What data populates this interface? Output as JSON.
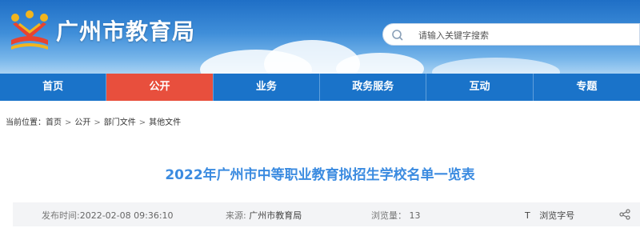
{
  "header": {
    "site_title": "广州市教育局",
    "search": {
      "placeholder": "请输入关键字搜索"
    },
    "logo_icon": "guangzhou-education-emblem"
  },
  "nav": {
    "items": [
      {
        "label": "首页",
        "active": false
      },
      {
        "label": "公开",
        "active": true
      },
      {
        "label": "业务",
        "active": false
      },
      {
        "label": "政务服务",
        "active": false
      },
      {
        "label": "互动",
        "active": false
      },
      {
        "label": "专题",
        "active": false
      }
    ]
  },
  "breadcrumb": {
    "prefix": "当前位置：",
    "items": [
      "首页",
      "公开",
      "部门文件",
      "其他文件"
    ],
    "separator": ">"
  },
  "article": {
    "title": "2022年广州市中等职业教育拟招生学校名单一览表",
    "publish_time_label": "发布时间:",
    "publish_time": "2022-02-08 09:36:10",
    "source_label": "来源:",
    "source": "广州市教育局",
    "views_label": "浏览量：",
    "views": "13",
    "font_icon_glyph": "T",
    "font_size_label": "浏览字号",
    "share_icon": "share-icon"
  },
  "colors": {
    "nav_bg": "#1a73c9",
    "nav_active": "#e84f3d",
    "title_color": "#3b8be0",
    "meta_bg": "#f3f4f6"
  }
}
